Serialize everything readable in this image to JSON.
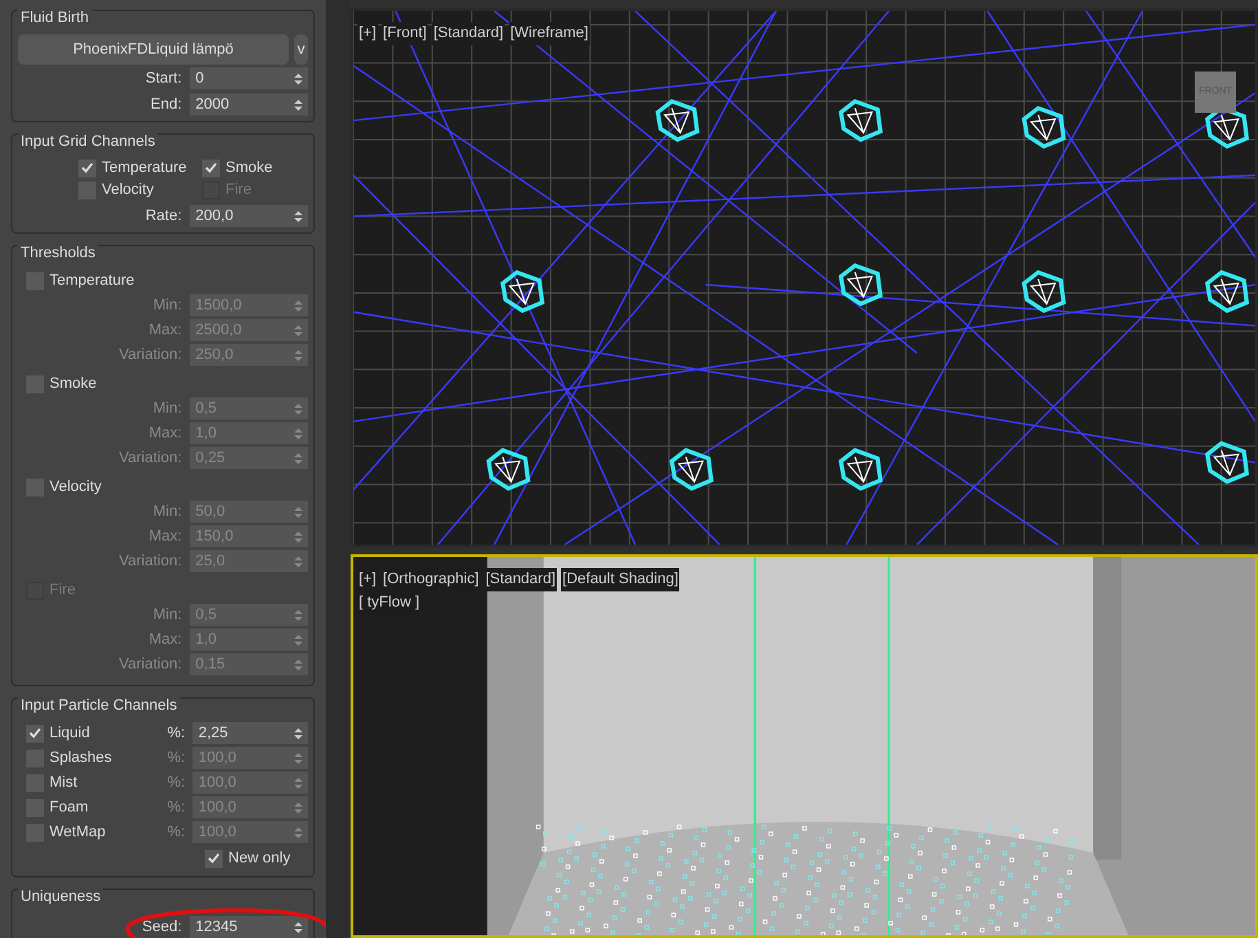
{
  "fluid_birth": {
    "title": "Fluid Birth",
    "source_button": "PhoenixFDLiquid lämpö",
    "menu_button": "v",
    "fields": [
      {
        "label": "Start:",
        "value": "0"
      },
      {
        "label": "End:",
        "value": "2000"
      }
    ]
  },
  "input_grid_channels": {
    "title": "Input Grid Channels",
    "checkboxes": [
      {
        "label": "Temperature",
        "checked": true,
        "disabled": false
      },
      {
        "label": "Smoke",
        "checked": true,
        "disabled": false
      },
      {
        "label": "Velocity",
        "checked": false,
        "disabled": false
      },
      {
        "label": "Fire",
        "checked": false,
        "disabled": true
      }
    ],
    "rate": {
      "label": "Rate:",
      "value": "200,0"
    }
  },
  "thresholds": {
    "title": "Thresholds",
    "groups": [
      {
        "label": "Temperature",
        "checked": false,
        "disabled": false,
        "fields": [
          {
            "label": "Min:",
            "value": "1500,0"
          },
          {
            "label": "Max:",
            "value": "2500,0"
          },
          {
            "label": "Variation:",
            "value": "250,0"
          }
        ]
      },
      {
        "label": "Smoke",
        "checked": false,
        "disabled": false,
        "fields": [
          {
            "label": "Min:",
            "value": "0,5"
          },
          {
            "label": "Max:",
            "value": "1,0"
          },
          {
            "label": "Variation:",
            "value": "0,25"
          }
        ]
      },
      {
        "label": "Velocity",
        "checked": false,
        "disabled": false,
        "fields": [
          {
            "label": "Min:",
            "value": "50,0"
          },
          {
            "label": "Max:",
            "value": "150,0"
          },
          {
            "label": "Variation:",
            "value": "25,0"
          }
        ]
      },
      {
        "label": "Fire",
        "checked": false,
        "disabled": true,
        "fields": [
          {
            "label": "Min:",
            "value": "0,5"
          },
          {
            "label": "Max:",
            "value": "1,0"
          },
          {
            "label": "Variation:",
            "value": "0,15"
          }
        ]
      }
    ]
  },
  "input_particle_channels": {
    "title": "Input Particle Channels",
    "channels": [
      {
        "label": "Liquid",
        "checked": true,
        "percent_label": "%:",
        "value": "2,25"
      },
      {
        "label": "Splashes",
        "checked": false,
        "percent_label": "%:",
        "value": "100,0"
      },
      {
        "label": "Mist",
        "checked": false,
        "percent_label": "%:",
        "value": "100,0"
      },
      {
        "label": "Foam",
        "checked": false,
        "percent_label": "%:",
        "value": "100,0"
      },
      {
        "label": "WetMap",
        "checked": false,
        "percent_label": "%:",
        "value": "100,0"
      }
    ],
    "new_only": {
      "label": "New only",
      "checked": true
    }
  },
  "uniqueness": {
    "title": "Uniqueness",
    "seed": {
      "label": "Seed:",
      "value": "12345",
      "circled": true
    }
  },
  "viewports": [
    {
      "kind": "wireframe",
      "selected": false,
      "labels": [
        "[+]",
        "[Front]",
        "[Standard]",
        "[Wireframe]"
      ],
      "viewcube_label": "FRONT"
    },
    {
      "kind": "shaded",
      "selected": true,
      "labels": [
        "[+]",
        "[Orthographic]",
        "[Standard]",
        "[Default Shading]"
      ],
      "sublabel": "[ tyFlow ]"
    }
  ]
}
